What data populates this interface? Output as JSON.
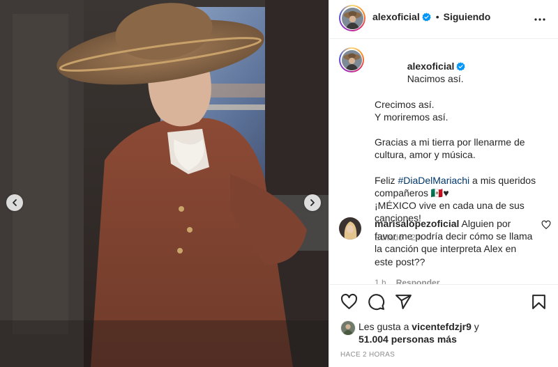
{
  "header": {
    "username": "alexoficial",
    "dot": "•",
    "follow_status": "Siguiendo",
    "more_icon": "more-horizontal-icon"
  },
  "caption": {
    "username": "alexoficial",
    "text_line1": "Nacimos así.",
    "text_line2": "Crecimos así.",
    "text_line3": "Y moriremos así.",
    "text_para2": "Gracias a mi tierra por llenarme de cultura, amor y música.",
    "text_para3_prefix": "Feliz ",
    "hashtag": "#DiaDelMariachi",
    "text_para3_suffix": " a mis queridos compañeros 🇲🇽♥",
    "text_para4": "¡MÉXICO vive en cada una de sus canciones!",
    "edited_label": "Editado",
    "time": "2 h"
  },
  "comment": {
    "username": "marisalopezoficial",
    "text": "Alguien por favor me podría decir cómo se llama la canción que interpreta Alex en este post??",
    "time": "1 h",
    "reply_label": "Responder"
  },
  "likes": {
    "prefix": "Les gusta a ",
    "user": "vicentefdzjr9",
    "connector": " y",
    "count_text": "51.004 personas más"
  },
  "posted_time": "Hace 2 horas",
  "colors": {
    "text": "#262626",
    "secondary": "#8e8e8e",
    "link": "#00376b",
    "verified": "#0095f6",
    "border": "#efefef"
  }
}
